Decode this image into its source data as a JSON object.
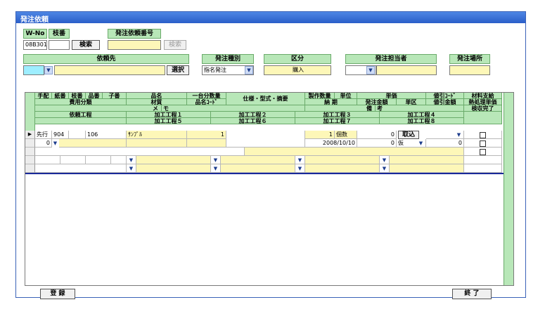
{
  "window": {
    "title": "発注依頼"
  },
  "top": {
    "wno_label": "W-No",
    "wno_value": "08B301",
    "edaban_label": "枝番",
    "edaban_value": "",
    "search_label": "検索",
    "order_no_label": "発注依頼番号",
    "order_no_value": "",
    "search2_label": "検索",
    "requester_label": "依頼先",
    "requester_value": "",
    "select_label": "選択",
    "order_type_label": "発注種別",
    "order_type_value": "指名発注",
    "kubun_label": "区分",
    "kubun_value": "購入",
    "person_label": "発注担当者",
    "person_value": "",
    "place_label": "発注場所",
    "place_value": ""
  },
  "grid": {
    "header1": [
      "手配",
      "紙番",
      "枝番",
      "品番",
      "子番",
      "品名",
      "一台分数量",
      "仕様・型式・摘要",
      "製作数量",
      "単位",
      "単価",
      "値引ｺｰﾄﾞ",
      "材料支給"
    ],
    "header2": [
      "費用分類",
      "材質",
      "品名ｺｰﾄﾞ",
      "納 期",
      "発注金額",
      "単区",
      "値引金額",
      "熱処理単価"
    ],
    "header3": [
      "メ",
      "モ",
      "備",
      "考",
      "検収完了"
    ],
    "header4": [
      "依頼工程",
      "加工工程１",
      "加工工程２",
      "加工工程３",
      "加工工程４"
    ],
    "header5": [
      "加工工程５",
      "加工工程６",
      "加工工程７",
      "加工工程８"
    ],
    "row1": {
      "tehai": "先行",
      "kami": "904",
      "hinban": "106",
      "hinmei": "ｻﾝﾌﾟﾙ",
      "qty1": "1",
      "make_qty": "1",
      "unit": "個数",
      "price": "0",
      "torikomi": "取込"
    },
    "row2": {
      "cost_class": "0",
      "due": "2008/10/10",
      "amount": "0",
      "tanku": "仮",
      "discount": "0"
    }
  },
  "bottom": {
    "register_label": "登 録",
    "end_label": "終 了"
  },
  "icons": {
    "dropdown": "chevron-down-icon",
    "row_pointer": "triangle-right-icon"
  }
}
